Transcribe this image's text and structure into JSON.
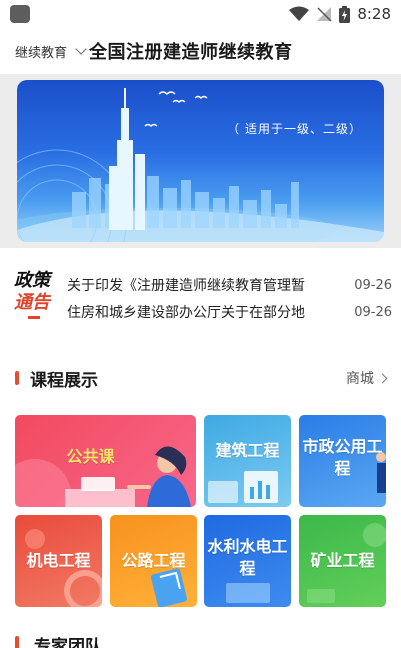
{
  "status_bar": {
    "time": "8:28"
  },
  "header": {
    "org_selector": "继续教育",
    "title": "全国注册建造师继续教育"
  },
  "banner": {
    "caption": "（ 适用于一级、二级）"
  },
  "policy": {
    "logo_line1": "政策",
    "logo_line2": "通告",
    "items": [
      {
        "title": "关于印发《注册建造师继续教育管理暂",
        "date": "09-26"
      },
      {
        "title": "住房和城乡建设部办公厅关于在部分地",
        "date": "09-26"
      }
    ]
  },
  "courses": {
    "title": "课程展示",
    "more": "商城",
    "tiles": [
      {
        "label": "公共课"
      },
      {
        "label": "建筑工程"
      },
      {
        "label": "市政公用工程"
      },
      {
        "label": "机电工程"
      },
      {
        "label": "公路工程"
      },
      {
        "label": "水利水电工程"
      },
      {
        "label": "矿业工程"
      }
    ]
  },
  "next_section": {
    "title": "专家团队"
  },
  "colors": {
    "accent": "#e2502f",
    "banner_blue": "#2a6ee3"
  }
}
